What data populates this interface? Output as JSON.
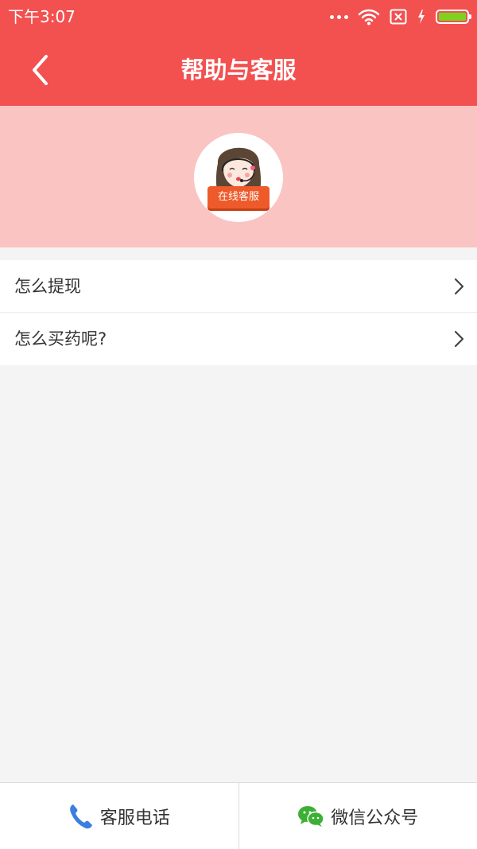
{
  "status_bar": {
    "time": "下午3:07",
    "battery_color": "#7ed321"
  },
  "header": {
    "title": "帮助与客服",
    "back_icon": "chevron-left-icon",
    "background": "#f25150"
  },
  "hero": {
    "background": "#fac4c3",
    "avatar": "customer-service-agent",
    "badge_label": "在线客服"
  },
  "menu": {
    "items": [
      {
        "label": "怎么提现",
        "icon": "chevron-right-icon"
      },
      {
        "label": "怎么买药呢?",
        "icon": "chevron-right-icon"
      }
    ]
  },
  "bottom_bar": {
    "phone_label": "客服电话",
    "phone_icon": "phone-icon",
    "phone_icon_color": "#3a7ee0",
    "wechat_label": "微信公众号",
    "wechat_icon": "wechat-icon",
    "wechat_icon_color": "#3cb034"
  }
}
